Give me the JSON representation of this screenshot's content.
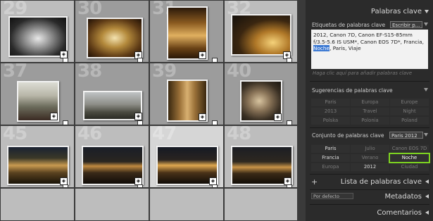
{
  "grid": {
    "cells": [
      {
        "num": "29",
        "tone": "light"
      },
      {
        "num": "30",
        "tone": "mid"
      },
      {
        "num": "31",
        "tone": "mid"
      },
      {
        "num": "32",
        "tone": "light"
      },
      {
        "num": "37",
        "tone": "mid"
      },
      {
        "num": "38",
        "tone": "mid"
      },
      {
        "num": "39",
        "tone": "mid"
      },
      {
        "num": "40",
        "tone": "mid"
      },
      {
        "num": "45",
        "tone": "light"
      },
      {
        "num": "46",
        "tone": "light"
      },
      {
        "num": "47",
        "tone": "sel"
      },
      {
        "num": "48",
        "tone": "light"
      }
    ]
  },
  "panel": {
    "title": "Palabras clave",
    "keyword_tags": {
      "label": "Etiquetas de palabras clave",
      "mode": "Escribir p...",
      "text_before": "2012, Canon 7D, Canon EF-S15-85mm f/3.5-5.6 IS USM*, Canon EOS 7D*, Francia, ",
      "highlight": "Noche",
      "text_after": ", Paris, Viaje",
      "hint": "Haga clic aquí para añadir palabras clave"
    },
    "suggestions": {
      "label": "Sugerencias de palabras clave",
      "items": [
        "Paris",
        "Europa",
        "Europe",
        "2013",
        "Travel",
        "Night",
        "Polska",
        "Polonia",
        "Poland"
      ]
    },
    "keyword_set": {
      "label": "Conjunto de palabras clave",
      "selected": "Paris 2012",
      "items": [
        "Paris",
        "Julio",
        "Canon EOS 7D",
        "Francia",
        "Verano",
        "Noche",
        "Europa",
        "2012",
        "Ciudad"
      ]
    },
    "keyword_list": {
      "title": "Lista de palabras clave",
      "add": "+"
    },
    "metadata": {
      "title": "Metadatos",
      "preset": "Por defecto"
    },
    "comments": {
      "title": "Comentarios"
    }
  }
}
